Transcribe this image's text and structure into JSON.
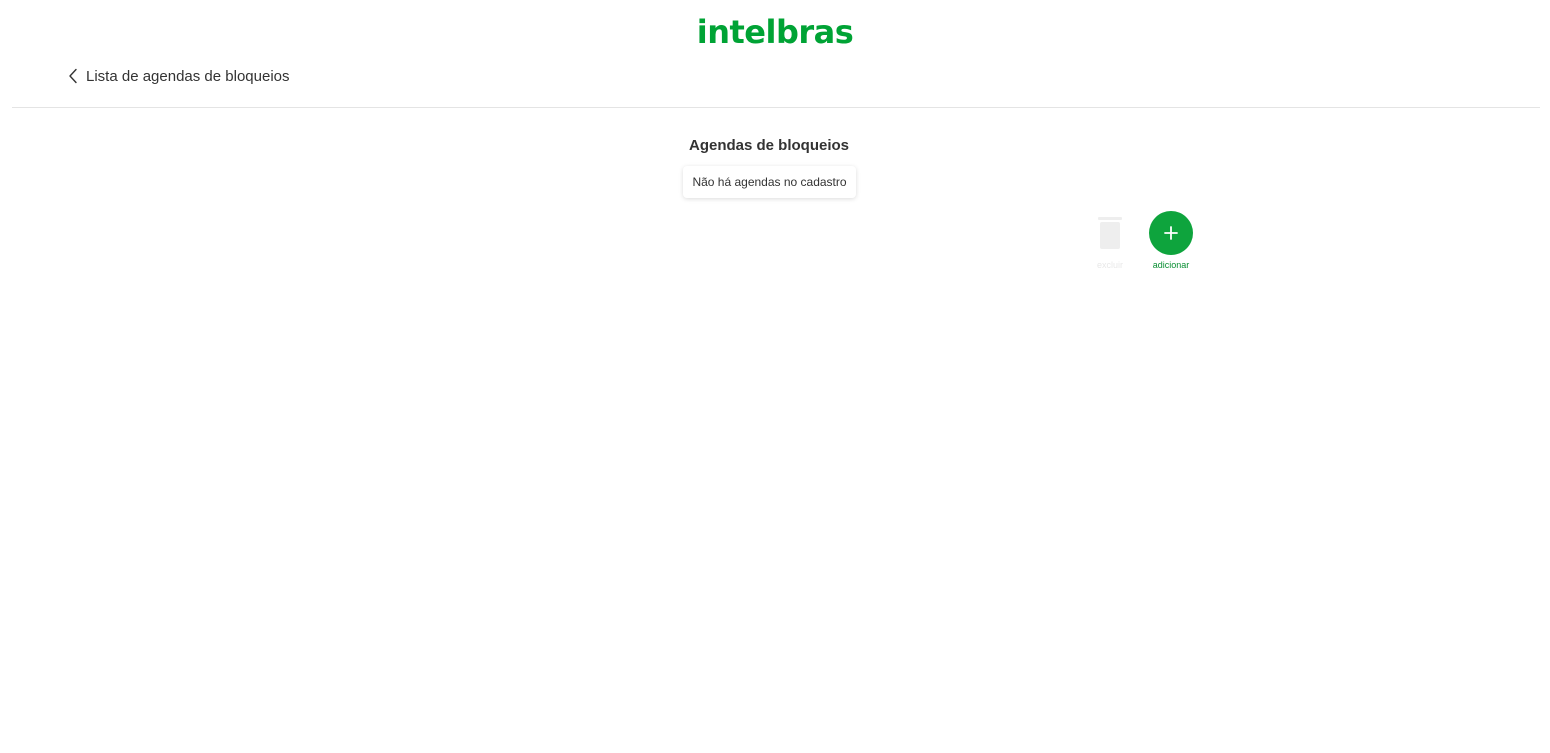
{
  "header": {
    "logo_text": "intelbras",
    "brand_color": "#00a335"
  },
  "nav": {
    "back_label": "Lista de agendas de bloqueios",
    "back_icon": "chevron-left-icon"
  },
  "main": {
    "title": "Agendas de bloqueios",
    "empty_message": "Não há agendas no cadastro"
  },
  "actions": {
    "delete": {
      "label": "excluir",
      "icon": "trash-icon",
      "enabled": false,
      "color": "#e8e8e8"
    },
    "add": {
      "label": "adicionar",
      "icon": "plus-icon",
      "enabled": true,
      "color": "#0ea43d"
    }
  }
}
